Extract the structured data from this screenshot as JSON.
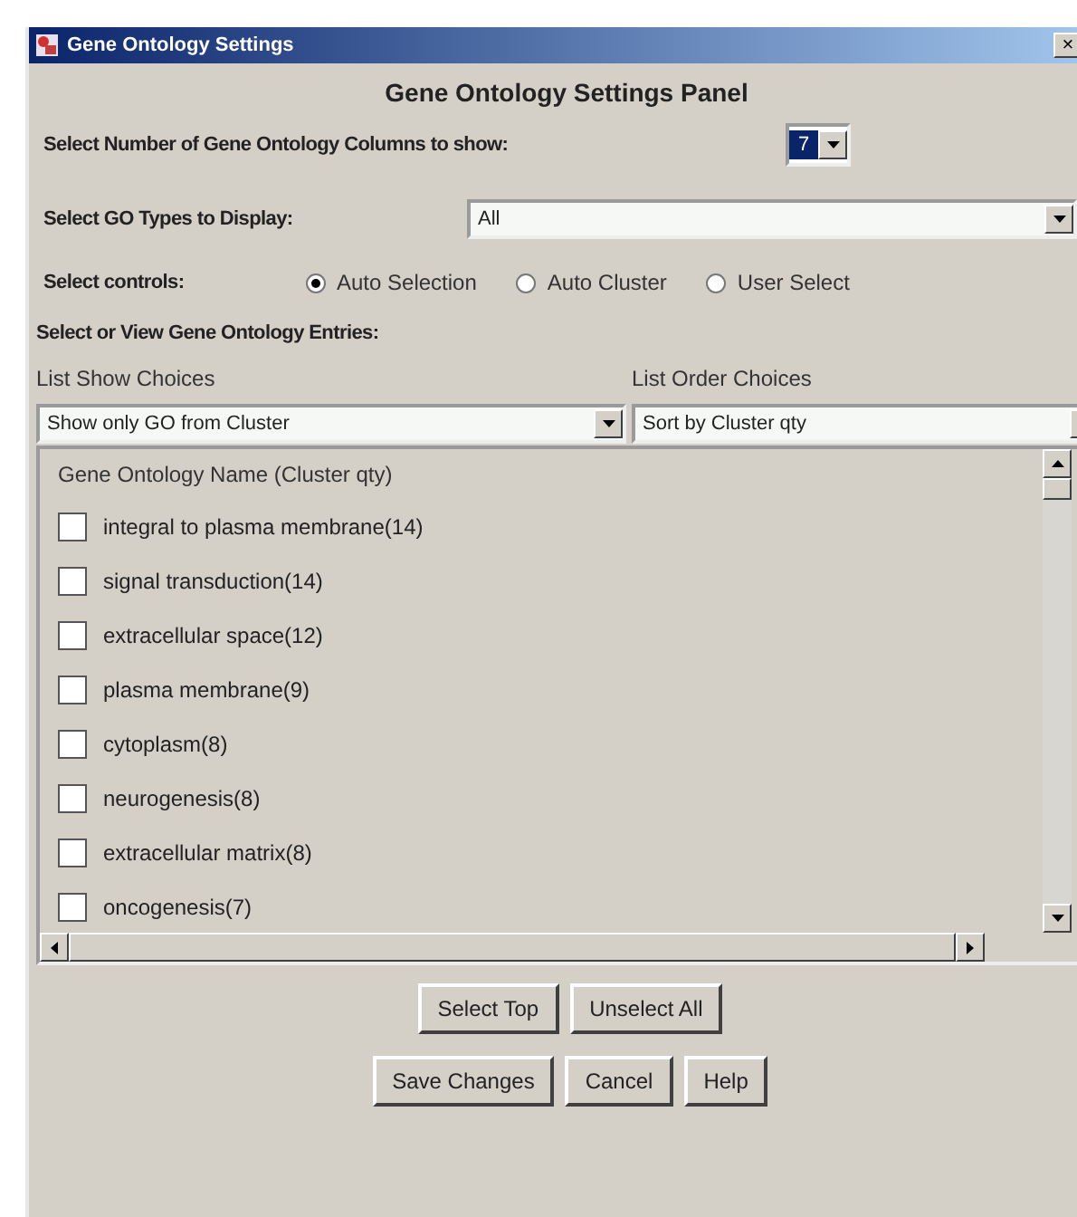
{
  "window": {
    "title": "Gene Ontology Settings",
    "close": "×"
  },
  "panel_title": "Gene Ontology Settings Panel",
  "columns_select": {
    "label": "Select Number of Gene Ontology Columns to show:",
    "value": "7"
  },
  "types_select": {
    "label": "Select GO Types to Display:",
    "value": "All"
  },
  "controls": {
    "label": "Select controls:",
    "options": [
      {
        "label": "Auto Selection",
        "selected": true
      },
      {
        "label": "Auto Cluster",
        "selected": false
      },
      {
        "label": "User Select",
        "selected": false
      }
    ]
  },
  "entries_label": "Select or View Gene Ontology Entries:",
  "show_choices": {
    "label": "List Show Choices",
    "value": "Show only GO from Cluster"
  },
  "order_choices": {
    "label": "List Order Choices",
    "value": "Sort by Cluster qty"
  },
  "list": {
    "header": "Gene Ontology Name (Cluster qty)",
    "items": [
      {
        "label": "integral to plasma membrane(14)",
        "checked": false
      },
      {
        "label": "signal transduction(14)",
        "checked": false
      },
      {
        "label": "extracellular space(12)",
        "checked": false
      },
      {
        "label": "plasma membrane(9)",
        "checked": false
      },
      {
        "label": "cytoplasm(8)",
        "checked": false
      },
      {
        "label": "neurogenesis(8)",
        "checked": false
      },
      {
        "label": "extracellular matrix(8)",
        "checked": false
      },
      {
        "label": "oncogenesis(7)",
        "checked": false
      }
    ]
  },
  "buttons_row1": [
    "Select Top",
    "Unselect All"
  ],
  "buttons_row2": [
    "Save Changes",
    "Cancel",
    "Help"
  ]
}
